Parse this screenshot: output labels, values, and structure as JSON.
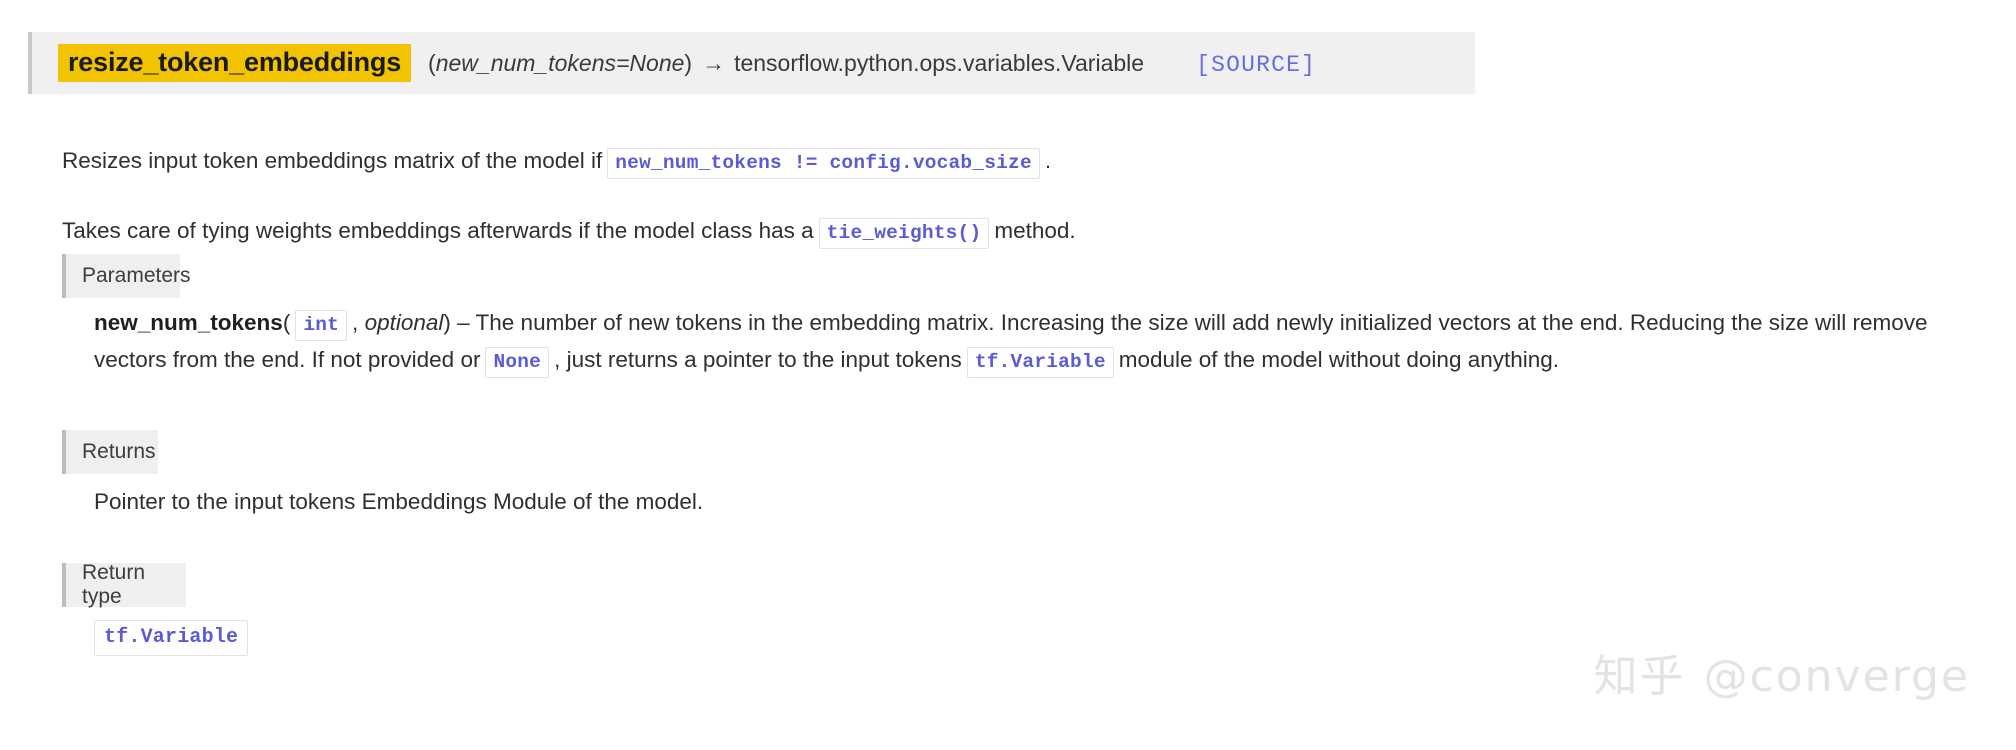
{
  "signature": {
    "method_name": "resize_token_embeddings",
    "params_open": "(",
    "params": "new_num_tokens=None",
    "params_close": ")",
    "arrow": "→",
    "return_type": "tensorflow.python.ops.variables.Variable",
    "source_link": "[SOURCE]",
    "highlight_color": "#f2c300",
    "source_link_color": "#6a6ce0"
  },
  "description": {
    "paragraph_1_before": "Resizes input token embeddings matrix of the model if",
    "paragraph_1_code": "new_num_tokens != config.vocab_size",
    "paragraph_1_after": ".",
    "paragraph_2_before": "Takes care of tying weights embeddings afterwards if the model class has a",
    "paragraph_2_code": "tie_weights()",
    "paragraph_2_after": "method."
  },
  "fields": {
    "parameters": {
      "label": "Parameters",
      "param_name": "new_num_tokens",
      "type_open": "(",
      "type_code": "int",
      "type_sep": ",",
      "type_optional": "optional",
      "type_close": ")",
      "dash": "–",
      "desc_part_1": "The number of new tokens in the embedding matrix. Increasing the size will add newly initialized vectors at the end. Reducing the size will remove vectors from the end. If not provided or",
      "desc_code_1": "None",
      "desc_part_2": ", just returns a pointer to the input tokens",
      "desc_code_2": "tf.Variable",
      "desc_part_3": "module of the model without doing anything."
    },
    "returns": {
      "label": "Returns",
      "text": "Pointer to the input tokens Embeddings Module of the model."
    },
    "return_type": {
      "label": "Return type",
      "code": "tf.Variable"
    }
  },
  "watermark": {
    "logo": "知乎",
    "handle": "@converge"
  },
  "theme": {
    "code_text_color": "#5b5bd6",
    "field_header_bg": "#efefef",
    "signature_bg": "#f0f0f0"
  }
}
